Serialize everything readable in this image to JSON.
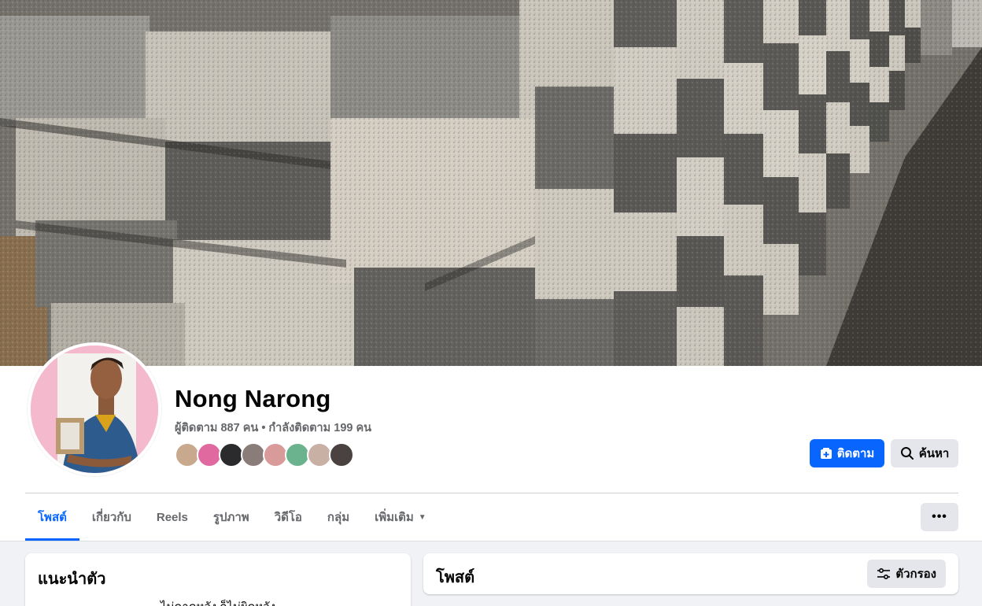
{
  "profile": {
    "name": "Nong Narong",
    "followers": "ผู้ติดตาม 887 คน",
    "separator": "•",
    "following": "กำลังติดตาม 199 คน"
  },
  "actions": {
    "follow_label": "ติดตาม",
    "search_label": "ค้นหา",
    "more_label": "•••"
  },
  "tabs": [
    {
      "label": "โพสต์",
      "active": true
    },
    {
      "label": "เกี่ยวกับ"
    },
    {
      "label": "Reels"
    },
    {
      "label": "รูปภาพ"
    },
    {
      "label": "วิดีโอ"
    },
    {
      "label": "กลุ่ม"
    },
    {
      "label": "เพิ่มเติม"
    }
  ],
  "intro": {
    "title": "แนะนำตัว",
    "bio": "ไม่คาดหวัง ก็ไม่ผิดหวัง"
  },
  "posts": {
    "title": "โพสต์",
    "filter_label": "ตัวกรอง"
  },
  "colors": {
    "accent": "#0866ff",
    "secondary_button": "#e4e6eb",
    "muted_text": "#65676b",
    "feed_background": "#f0f2f5"
  },
  "icons": {
    "follow": "user-plus-icon",
    "search": "search-icon",
    "more": "more-dots-icon",
    "dropdown": "caret-down-icon",
    "filter": "sliders-icon"
  }
}
